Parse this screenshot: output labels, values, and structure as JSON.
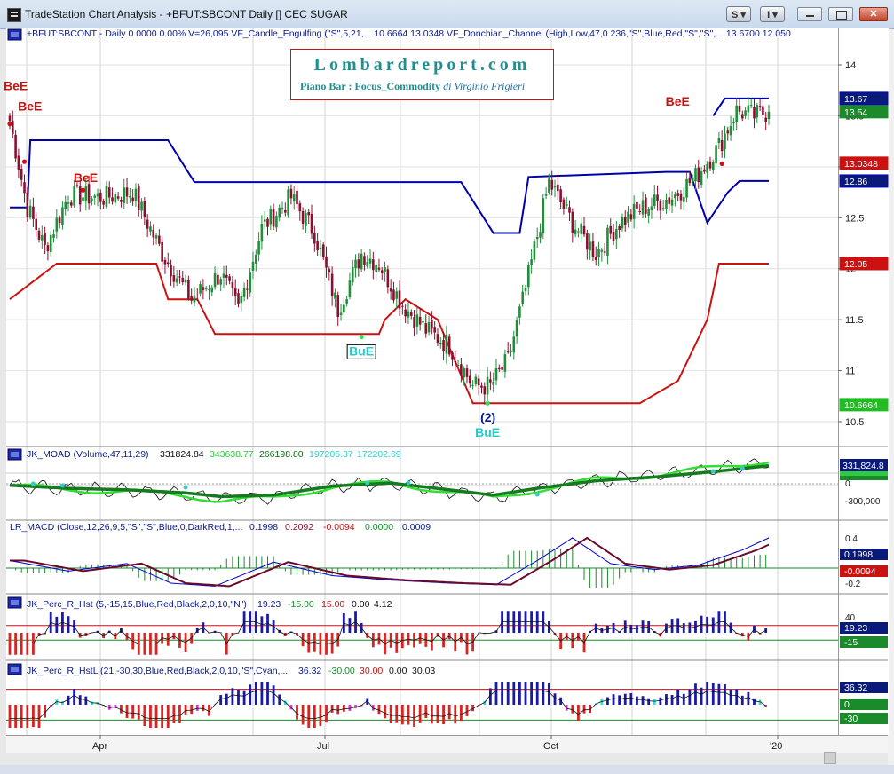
{
  "window": {
    "title": "TradeStation Chart Analysis - +BFUT:SBCONT Daily [] CEC SUGAR",
    "btn_s": "S",
    "btn_i": "I"
  },
  "logo": {
    "title": "Lombardreport.com",
    "subtitle": "Piano Bar : Focus_Commodity",
    "author": "di Virginio Frigieri"
  },
  "panels": {
    "price": {
      "header": "+BFUT:SBCONT - Daily  0.0000  0.00%  V=26,095  VF_Candle_Engulfing (\"S\",5,21,...  10.6664  13.0348  VF_Donchian_Channel (High,Low,47,0.236,\"S\",Blue,Red,\"S\",\"S\",...  13.6700  12.050",
      "tags": [
        {
          "value": "13.67",
          "bg": "#0a1a7a",
          "fg": "#ffffff",
          "border": "#0000cc"
        },
        {
          "value": "13.54",
          "bg": "#1a8a2a",
          "fg": "#ffffff",
          "border": "#1a8a2a"
        },
        {
          "value": "13.0348",
          "bg": "#cc1111",
          "fg": "#ffffff",
          "border": "#cc1111"
        },
        {
          "value": "12.86",
          "bg": "#0a1a7a",
          "fg": "#ffffff",
          "border": "#0000cc"
        },
        {
          "value": "12.05",
          "bg": "#cc1111",
          "fg": "#ffffff",
          "border": "#cc1111"
        },
        {
          "value": "10.6664",
          "bg": "#22bb22",
          "fg": "#ffffff",
          "border": "#22bb22"
        }
      ],
      "annotations": [
        "BeE",
        "BeE",
        "BeE",
        "BeE",
        "BuE",
        "BuE",
        "(2)"
      ]
    },
    "moad": {
      "header": "JK_MOAD (Volume,47,11,29)",
      "values": [
        "331824.84",
        "343638.77",
        "266198.80",
        "197205.37",
        "172202.69"
      ],
      "tags": [
        {
          "value": "331,824.8",
          "bg": "#0a1a7a",
          "fg": "#ffffff"
        },
        {
          "value": "",
          "bg": "#2ecc40",
          "fg": "#ffffff"
        },
        {
          "value": "",
          "bg": "#1a8a2a",
          "fg": "#ffffff"
        }
      ]
    },
    "macd": {
      "header": "LR_MACD (Close,12,26,9,5,\"S\",\"S\",Blue,0,DarkRed,1,...",
      "values": [
        "0.1998",
        "0.2092",
        "-0.0094",
        "0.0000",
        "0.0009"
      ],
      "tags": [
        {
          "value": "0.1998",
          "bg": "#0a1a7a",
          "fg": "#ffffff"
        },
        {
          "value": "-0.0094",
          "bg": "#cc1111",
          "fg": "#ffffff"
        }
      ]
    },
    "percr": {
      "header": "JK_Perc_R_Hst (5,-15,15,Blue,Red,Black,2,0,10,\"N\")",
      "values": [
        "19.23",
        "-15.00",
        "15.00",
        "0.00",
        "4.12"
      ],
      "tags": [
        {
          "value": "19.23",
          "bg": "#0a1a7a",
          "fg": "#ffffff"
        },
        {
          "value": "-15",
          "bg": "#1a8a2a",
          "fg": "#ffffff"
        }
      ]
    },
    "percrl": {
      "header": "JK_Perc_R_HstL (21,-30,30,Blue,Red,Black,2,0,10,\"S\",Cyan,...",
      "values": [
        "36.32",
        "-30.00",
        "30.00",
        "0.00",
        "30.03"
      ],
      "tags": [
        {
          "value": "36.32",
          "bg": "#0a1a7a",
          "fg": "#ffffff"
        },
        {
          "value": "0",
          "bg": "#1a8a2a",
          "fg": "#ffffff"
        },
        {
          "value": "-30",
          "bg": "#1a8a2a",
          "fg": "#ffffff"
        }
      ]
    }
  },
  "chart_data": {
    "type": "candlestick",
    "instrument": "+BFUT:SBCONT",
    "interval": "Daily",
    "price_axis": {
      "ticks": [
        "14",
        "13.5",
        "13",
        "12.5",
        "12",
        "11.5",
        "11",
        "10.5"
      ],
      "ylim": [
        10.2,
        14.35
      ]
    },
    "time_axis": {
      "labels": [
        "Apr",
        "Jul",
        "Oct",
        "'20"
      ]
    },
    "colors": {
      "up": "#1f8f3a",
      "down": "#8a1030",
      "donchian_upper": "#0000aa",
      "donchian_lower": "#cc1111"
    },
    "price_close_knots": [
      [
        0,
        13.45
      ],
      [
        6,
        12.6
      ],
      [
        12,
        12.2
      ],
      [
        20,
        12.72
      ],
      [
        32,
        12.7
      ],
      [
        42,
        12.75
      ],
      [
        52,
        12.15
      ],
      [
        62,
        11.7
      ],
      [
        72,
        11.95
      ],
      [
        78,
        11.6
      ],
      [
        86,
        12.4
      ],
      [
        96,
        12.7
      ],
      [
        104,
        12.35
      ],
      [
        112,
        11.6
      ],
      [
        120,
        12.15
      ],
      [
        126,
        12.05
      ],
      [
        134,
        11.65
      ],
      [
        142,
        11.4
      ],
      [
        150,
        11.25
      ],
      [
        158,
        10.85
      ],
      [
        164,
        10.85
      ],
      [
        170,
        11.1
      ],
      [
        176,
        11.8
      ],
      [
        184,
        12.85
      ],
      [
        192,
        12.45
      ],
      [
        200,
        12.15
      ],
      [
        208,
        12.45
      ],
      [
        216,
        12.6
      ],
      [
        226,
        12.7
      ],
      [
        234,
        12.9
      ],
      [
        242,
        13.2
      ],
      [
        248,
        13.55
      ],
      [
        254,
        13.5
      ],
      [
        259,
        13.54
      ]
    ],
    "donchian_upper_steps": [
      [
        0,
        12.6
      ],
      [
        6,
        12.6
      ],
      [
        7,
        13.26
      ],
      [
        54,
        13.26
      ],
      [
        63,
        12.85
      ],
      [
        154,
        12.85
      ],
      [
        165,
        12.35
      ],
      [
        174,
        12.35
      ],
      [
        177,
        12.9
      ],
      [
        224,
        12.95
      ],
      [
        232,
        12.95
      ],
      [
        238,
        12.45
      ],
      [
        245,
        12.75
      ],
      [
        249,
        12.86
      ],
      [
        259,
        12.86
      ]
    ],
    "donchian_lower_steps": [
      [
        0,
        11.7
      ],
      [
        16,
        12.05
      ],
      [
        50,
        12.05
      ],
      [
        54,
        11.7
      ],
      [
        64,
        11.7
      ],
      [
        70,
        11.36
      ],
      [
        126,
        11.36
      ],
      [
        128,
        11.5
      ],
      [
        135,
        11.7
      ],
      [
        146,
        11.5
      ],
      [
        158,
        10.68
      ],
      [
        215,
        10.68
      ],
      [
        228,
        10.9
      ],
      [
        238,
        11.5
      ],
      [
        242,
        12.05
      ],
      [
        259,
        12.05
      ]
    ],
    "annotations": [
      {
        "text": "BeE",
        "x": 0,
        "y": 13.75,
        "color": "#cc1111"
      },
      {
        "text": "BeE",
        "x": 7,
        "y": 13.55,
        "color": "#cc1111"
      },
      {
        "text": "BeE",
        "x": 26,
        "y": 12.85,
        "color": "#cc1111"
      },
      {
        "text": "BeE",
        "x": 228,
        "y": 13.6,
        "color": "#cc1111"
      },
      {
        "text": "BuE",
        "x": 120,
        "y": 11.15,
        "color": "#22cccc",
        "boxed": true
      },
      {
        "text": "(2)",
        "x": 163,
        "y": 10.5,
        "color": "#0a1a8a"
      },
      {
        "text": "BuE",
        "x": 163,
        "y": 10.35,
        "color": "#22cccc"
      }
    ],
    "last_bar": {
      "high": 13.67,
      "close": 13.54
    }
  }
}
